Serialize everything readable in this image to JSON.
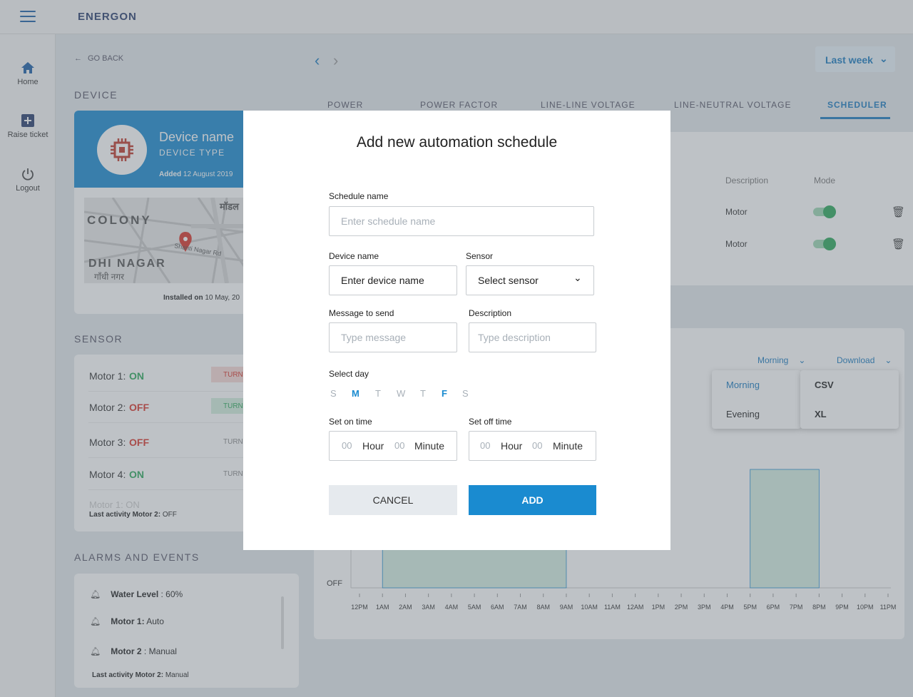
{
  "app": {
    "logo": "ENERGON"
  },
  "sidebar": {
    "items": [
      {
        "label": "Home"
      },
      {
        "label": "Raise ticket"
      },
      {
        "label": "Logout"
      }
    ]
  },
  "nav": {
    "go_back": "GO BACK"
  },
  "device": {
    "section_title": "DEVICE",
    "name": "Device name",
    "type": "DEVICE TYPE",
    "added_prefix": "Added",
    "added_date": "12 August 2019",
    "installed_prefix": "Installed on",
    "installed_date": "10 May, 20"
  },
  "map": {
    "labels": [
      "COLONY",
      "DHI NAGAR",
      "गाँधी नगर",
      "मॉडल",
      "Shanti Nagar Rd"
    ]
  },
  "sensor": {
    "section_title": "SENSOR",
    "rows": [
      {
        "label": "Motor 1:",
        "status": "ON",
        "action": "TURN"
      },
      {
        "label": "Motor 2:",
        "status": "OFF",
        "action": "TURN"
      },
      {
        "label": "Motor 3:",
        "status": "OFF",
        "action": "TURN"
      },
      {
        "label": "Motor 4:",
        "status": "ON",
        "action": "TURN"
      }
    ],
    "last_activity_label": "Last activity Motor 2:",
    "last_activity_value": "OFF",
    "faded_row": "Motor 1: ON"
  },
  "alarms": {
    "section_title": "ALARMS AND EVENTS",
    "rows": [
      {
        "label": "Water Level",
        "value": ": 60%"
      },
      {
        "label": "Motor 1:",
        "value": "Auto"
      },
      {
        "label": "Motor 2",
        "value": ": Manual"
      }
    ],
    "last_activity_label": "Last activity Motor 2:",
    "last_activity_value": "Manual"
  },
  "tabs": [
    "POWER",
    "POWER FACTOR",
    "LINE-LINE VOLTAGE",
    "LINE-NEUTRAL VOLTAGE",
    "SCHEDULER"
  ],
  "range": {
    "selected": "Last week"
  },
  "schedule_table": {
    "columns": [
      "Description",
      "Mode"
    ],
    "rows": [
      {
        "description": "Motor",
        "mode_on": true
      },
      {
        "description": "Motor",
        "mode_on": true
      }
    ]
  },
  "chart_controls": {
    "period_selected": "Morning",
    "download_label": "Download",
    "period_options": [
      "Morning",
      "Evening"
    ],
    "download_options": [
      "CSV",
      "XL"
    ]
  },
  "chart_data": {
    "type": "bar",
    "categories": [
      "12PM",
      "1AM",
      "2AM",
      "3AM",
      "4AM",
      "5AM",
      "6AM",
      "7AM",
      "8AM",
      "9AM",
      "10AM",
      "11AM",
      "12AM",
      "1PM",
      "2PM",
      "3PM",
      "4PM",
      "5PM",
      "6PM",
      "7PM",
      "8PM",
      "9PM",
      "10PM",
      "11PM"
    ],
    "y_label_visible": "OFF",
    "on_intervals": [
      {
        "start": "1AM",
        "end": "9AM"
      },
      {
        "start": "5PM",
        "end": "8PM"
      }
    ]
  },
  "modal": {
    "title": "Add new automation schedule",
    "schedule_name_label": "Schedule name",
    "schedule_name_placeholder": "Enter schedule name",
    "device_name_label": "Device name",
    "device_name_placeholder": "Enter device name",
    "sensor_label": "Sensor",
    "sensor_value": "Select sensor",
    "message_label": "Message to send",
    "message_placeholder": "Type message",
    "description_label": "Description",
    "description_placeholder": "Type description",
    "select_day_label": "Select day",
    "days": [
      {
        "letter": "S",
        "active": false
      },
      {
        "letter": "M",
        "active": true
      },
      {
        "letter": "T",
        "active": false
      },
      {
        "letter": "W",
        "active": false
      },
      {
        "letter": "T",
        "active": false
      },
      {
        "letter": "F",
        "active": true
      },
      {
        "letter": "S",
        "active": false
      }
    ],
    "on_time_label": "Set on time",
    "off_time_label": "Set off time",
    "hour_placeholder": "00",
    "minute_placeholder": "00",
    "hour_label": "Hour",
    "minute_label": "Minute",
    "cancel_label": "CANCEL",
    "add_label": "ADD"
  },
  "colors": {
    "primary": "#1a8bd0",
    "on": "#2eaa5c",
    "off": "#d9352a",
    "bar_fill": "#d6efe3"
  }
}
